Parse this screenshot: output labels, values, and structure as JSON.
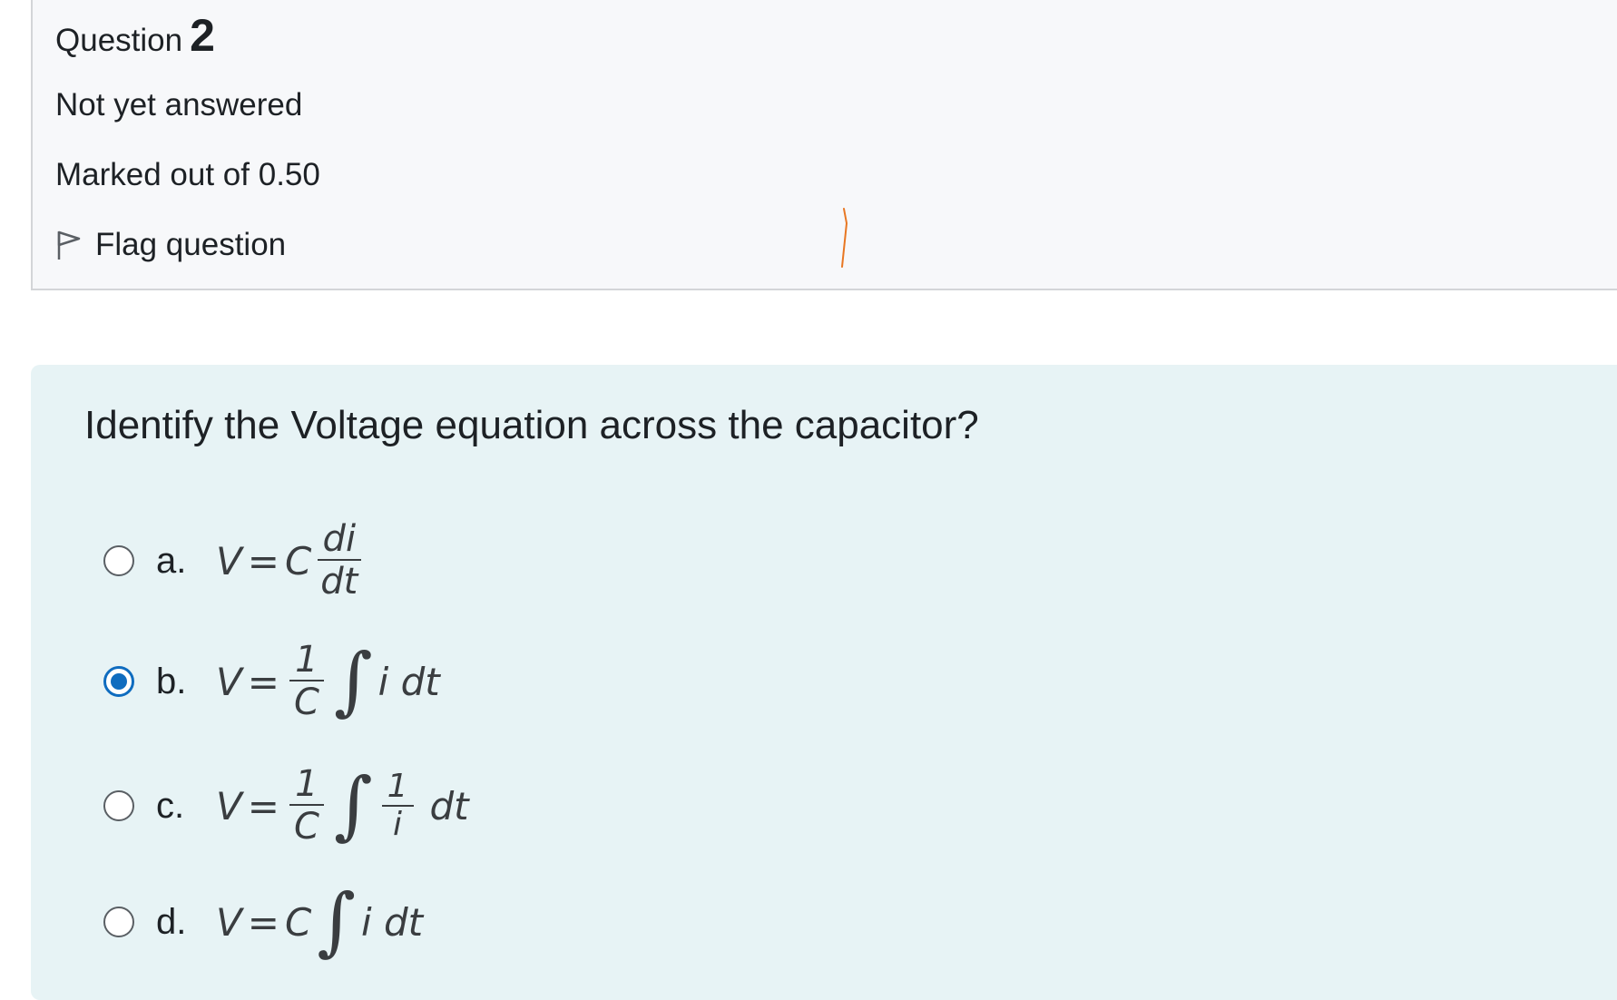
{
  "info": {
    "question_word": "Question",
    "question_number": "2",
    "state": "Not yet answered",
    "grade": "Marked out of 0.50",
    "flag_label": "Flag question"
  },
  "question": {
    "text": "Identify the Voltage equation across the capacitor?",
    "selected": "b",
    "answers": [
      {
        "label": "a.",
        "checked": false,
        "v": "V",
        "eq": "=",
        "c": "C",
        "num": "di",
        "den": "dt"
      },
      {
        "label": "b.",
        "checked": true,
        "v": "V",
        "eq": "=",
        "num": "1",
        "den": "C",
        "integral": "∫",
        "body": "i dt"
      },
      {
        "label": "c.",
        "checked": false,
        "v": "V",
        "eq": "=",
        "num": "1",
        "den": "C",
        "integral": "∫",
        "inner_num": "1",
        "inner_den": "i",
        "tail": "dt"
      },
      {
        "label": "d.",
        "checked": false,
        "v": "V",
        "eq": "=",
        "c": "C",
        "integral": "∫",
        "body": "i dt"
      }
    ]
  },
  "colors": {
    "accent": "#0f6cbf",
    "info_bg": "#f7f8fa",
    "content_bg": "#e7f3f5",
    "annotation": "#e87722"
  }
}
